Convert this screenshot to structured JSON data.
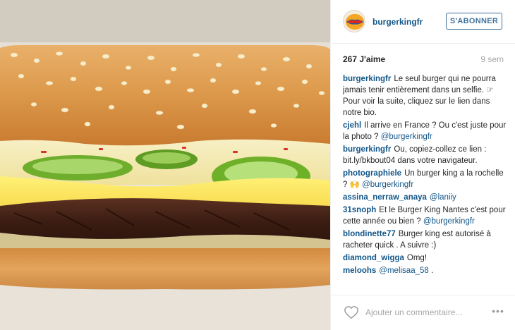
{
  "post": {
    "photo_description_icon": "burger-photo",
    "header": {
      "username": "burgerkingfr",
      "follow_label": "S'ABONNER"
    },
    "likes": "267 J'aime",
    "time": "9 sem",
    "comments": [
      {
        "user": "burgerkingfr",
        "text": "Le seul burger qui ne pourra jamais tenir entièrement dans un selfie. ☞ Pour voir la suite, cliquez sur le lien dans notre bio.",
        "mention": ""
      },
      {
        "user": "cjehl",
        "text": "Il arrive en France ? Ou c'est juste pour la photo ?",
        "mention": "@burgerkingfr"
      },
      {
        "user": "burgerkingfr",
        "text": "Ou, copiez-collez ce lien : bit.ly/bkbout04 dans votre navigateur.",
        "mention": ""
      },
      {
        "user": "photographiele",
        "text": "Un burger king a la rochelle ? 🙌",
        "mention": "@burgerkingfr"
      },
      {
        "user": "assina_nerraw_anaya",
        "text": "",
        "mention": "@laniiy"
      },
      {
        "user": "31snoph",
        "text": "Et le Burger King Nantes c'est pour cette année ou bien ?",
        "mention": "@burgerkingfr"
      },
      {
        "user": "blondinette77",
        "text": "Burger king est autorisé à racheter quick . A suivre :)",
        "mention": ""
      },
      {
        "user": "diamond_wigga",
        "text": "Omg!",
        "mention": ""
      },
      {
        "user": "meloohs",
        "text": ".",
        "mention": "@melisaa_58"
      }
    ],
    "comment_placeholder": "Ajouter un commentaire...",
    "more_label": "•••"
  },
  "colors": {
    "link": "#125688",
    "follow_border": "#3f729b",
    "muted": "#a5a7aa"
  },
  "icons": {
    "avatar": "burger-king-logo",
    "heart": "heart-outline-icon",
    "more": "more-dots-icon"
  }
}
